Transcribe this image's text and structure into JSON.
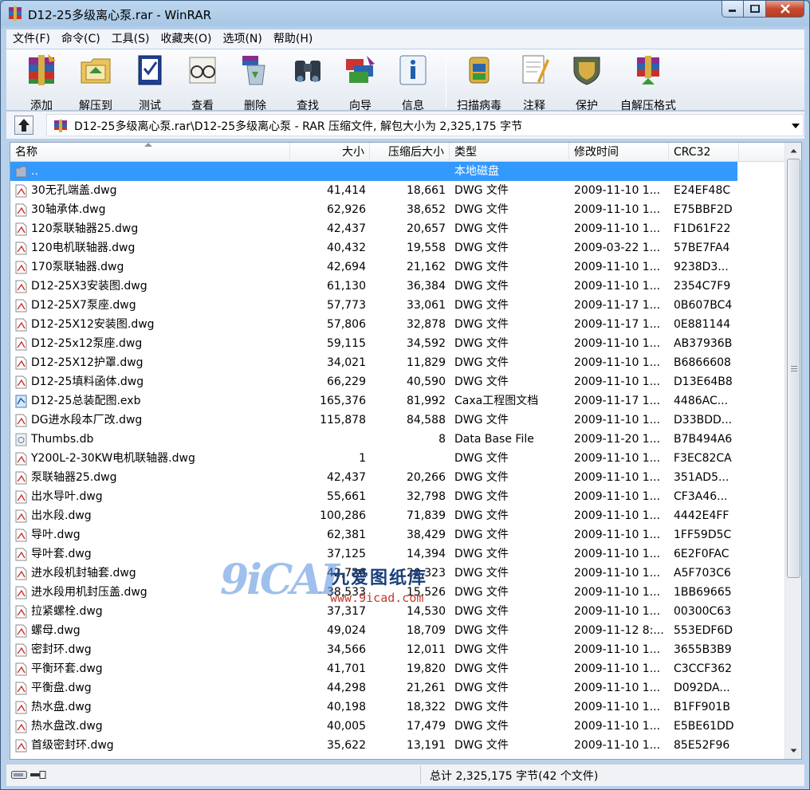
{
  "window": {
    "title": "D12-25多级离心泵.rar - WinRAR"
  },
  "menu": [
    "文件(F)",
    "命令(C)",
    "工具(S)",
    "收藏夹(O)",
    "选项(N)",
    "帮助(H)"
  ],
  "toolbar": [
    {
      "label": "添加",
      "icon": "add-books-icon"
    },
    {
      "label": "解压到",
      "icon": "extract-folder-icon"
    },
    {
      "label": "测试",
      "icon": "test-icon"
    },
    {
      "label": "查看",
      "icon": "view-glasses-icon"
    },
    {
      "label": "删除",
      "icon": "delete-recycle-icon"
    },
    {
      "label": "查找",
      "icon": "find-binoculars-icon"
    },
    {
      "label": "向导",
      "icon": "wizard-icon"
    },
    {
      "label": "信息",
      "icon": "info-icon"
    },
    {
      "label": "扫描病毒",
      "icon": "virus-scan-icon"
    },
    {
      "label": "注释",
      "icon": "comment-icon"
    },
    {
      "label": "保护",
      "icon": "protect-shield-icon"
    },
    {
      "label": "自解压格式",
      "icon": "sfx-icon"
    }
  ],
  "address": {
    "path": "D12-25多级离心泵.rar\\D12-25多级离心泵 - RAR 压缩文件, 解包大小为 2,325,175 字节"
  },
  "columns": {
    "name": "名称",
    "size": "大小",
    "packed": "压缩后大小",
    "type": "类型",
    "modified": "修改时间",
    "crc": "CRC32"
  },
  "files": [
    {
      "name": "..",
      "size": "",
      "packed": "",
      "type": "本地磁盘",
      "modified": "",
      "crc": "",
      "icon": "folder-up",
      "selected": true
    },
    {
      "name": "30无孔端盖.dwg",
      "size": "41,414",
      "packed": "18,661",
      "type": "DWG 文件",
      "modified": "2009-11-10 1...",
      "crc": "E24EF48C",
      "icon": "dwg"
    },
    {
      "name": "30轴承体.dwg",
      "size": "62,926",
      "packed": "38,652",
      "type": "DWG 文件",
      "modified": "2009-11-10 1...",
      "crc": "E75BBF2D",
      "icon": "dwg"
    },
    {
      "name": "120泵联轴器25.dwg",
      "size": "42,437",
      "packed": "20,657",
      "type": "DWG 文件",
      "modified": "2009-11-10 1...",
      "crc": "F1D61F22",
      "icon": "dwg"
    },
    {
      "name": "120电机联轴器.dwg",
      "size": "40,432",
      "packed": "19,558",
      "type": "DWG 文件",
      "modified": "2009-03-22 1...",
      "crc": "57BE7FA4",
      "icon": "dwg"
    },
    {
      "name": "170泵联轴器.dwg",
      "size": "42,694",
      "packed": "21,162",
      "type": "DWG 文件",
      "modified": "2009-11-10 1...",
      "crc": "9238D3...",
      "icon": "dwg"
    },
    {
      "name": "D12-25X3安装图.dwg",
      "size": "61,130",
      "packed": "36,384",
      "type": "DWG 文件",
      "modified": "2009-11-10 1...",
      "crc": "2354C7F9",
      "icon": "dwg"
    },
    {
      "name": "D12-25X7泵座.dwg",
      "size": "57,773",
      "packed": "33,061",
      "type": "DWG 文件",
      "modified": "2009-11-17 1...",
      "crc": "0B607BC4",
      "icon": "dwg"
    },
    {
      "name": "D12-25X12安装图.dwg",
      "size": "57,806",
      "packed": "32,878",
      "type": "DWG 文件",
      "modified": "2009-11-17 1...",
      "crc": "0E881144",
      "icon": "dwg"
    },
    {
      "name": "D12-25x12泵座.dwg",
      "size": "59,115",
      "packed": "34,592",
      "type": "DWG 文件",
      "modified": "2009-11-10 1...",
      "crc": "AB37936B",
      "icon": "dwg"
    },
    {
      "name": "D12-25X12护罩.dwg",
      "size": "34,021",
      "packed": "11,829",
      "type": "DWG 文件",
      "modified": "2009-11-10 1...",
      "crc": "B6866608",
      "icon": "dwg"
    },
    {
      "name": "D12-25填料函体.dwg",
      "size": "66,229",
      "packed": "40,590",
      "type": "DWG 文件",
      "modified": "2009-11-10 1...",
      "crc": "D13E64B8",
      "icon": "dwg"
    },
    {
      "name": "D12-25总装配图.exb",
      "size": "165,376",
      "packed": "81,992",
      "type": "Caxa工程图文档",
      "modified": "2009-11-17 1...",
      "crc": "4486AC...",
      "icon": "exb"
    },
    {
      "name": "DG进水段本厂改.dwg",
      "size": "115,878",
      "packed": "84,588",
      "type": "DWG 文件",
      "modified": "2009-11-10 1...",
      "crc": "D33BDD...",
      "icon": "dwg"
    },
    {
      "name": "Thumbs.db",
      "size": "",
      "packed": "8",
      "type": "Data Base File",
      "modified": "2009-11-20 1...",
      "crc": "B7B494A6",
      "icon": "db"
    },
    {
      "name": "Y200L-2-30KW电机联轴器.dwg",
      "size": "1",
      "packed": "",
      "type": "DWG 文件",
      "modified": "2009-11-10 1...",
      "crc": "F3EC82CA",
      "icon": "dwg"
    },
    {
      "name": "泵联轴器25.dwg",
      "size": "42,437",
      "packed": "20,266",
      "type": "DWG 文件",
      "modified": "2009-11-10 1...",
      "crc": "351AD5...",
      "icon": "dwg"
    },
    {
      "name": "出水导叶.dwg",
      "size": "55,661",
      "packed": "32,798",
      "type": "DWG 文件",
      "modified": "2009-11-10 1...",
      "crc": "CF3A46...",
      "icon": "dwg"
    },
    {
      "name": "出水段.dwg",
      "size": "100,286",
      "packed": "71,839",
      "type": "DWG 文件",
      "modified": "2009-11-10 1...",
      "crc": "4442E4FF",
      "icon": "dwg"
    },
    {
      "name": "导叶.dwg",
      "size": "62,381",
      "packed": "38,429",
      "type": "DWG 文件",
      "modified": "2009-11-10 1...",
      "crc": "1FF59D5C",
      "icon": "dwg"
    },
    {
      "name": "导叶套.dwg",
      "size": "37,125",
      "packed": "14,394",
      "type": "DWG 文件",
      "modified": "2009-11-10 1...",
      "crc": "6E2F0FAC",
      "icon": "dwg"
    },
    {
      "name": "进水段机封轴套.dwg",
      "size": "42,726",
      "packed": "20,323",
      "type": "DWG 文件",
      "modified": "2009-11-10 1...",
      "crc": "A5F703C6",
      "icon": "dwg"
    },
    {
      "name": "进水段用机封压盖.dwg",
      "size": "38,533",
      "packed": "15,526",
      "type": "DWG 文件",
      "modified": "2009-11-10 1...",
      "crc": "1BB69665",
      "icon": "dwg"
    },
    {
      "name": "拉紧螺栓.dwg",
      "size": "37,317",
      "packed": "14,530",
      "type": "DWG 文件",
      "modified": "2009-11-10 1...",
      "crc": "00300C63",
      "icon": "dwg"
    },
    {
      "name": "螺母.dwg",
      "size": "49,024",
      "packed": "18,709",
      "type": "DWG 文件",
      "modified": "2009-11-12 8:...",
      "crc": "553EDF6D",
      "icon": "dwg"
    },
    {
      "name": "密封环.dwg",
      "size": "34,566",
      "packed": "12,011",
      "type": "DWG 文件",
      "modified": "2009-11-10 1...",
      "crc": "3655B3B9",
      "icon": "dwg"
    },
    {
      "name": "平衡环套.dwg",
      "size": "41,701",
      "packed": "19,820",
      "type": "DWG 文件",
      "modified": "2009-11-10 1...",
      "crc": "C3CCF362",
      "icon": "dwg"
    },
    {
      "name": "平衡盘.dwg",
      "size": "44,298",
      "packed": "21,261",
      "type": "DWG 文件",
      "modified": "2009-11-10 1...",
      "crc": "D092DA...",
      "icon": "dwg"
    },
    {
      "name": "热水盘.dwg",
      "size": "40,198",
      "packed": "18,322",
      "type": "DWG 文件",
      "modified": "2009-11-10 1...",
      "crc": "B1FF901B",
      "icon": "dwg"
    },
    {
      "name": "热水盘改.dwg",
      "size": "40,005",
      "packed": "17,479",
      "type": "DWG 文件",
      "modified": "2009-11-10 1...",
      "crc": "E5BE61DD",
      "icon": "dwg"
    },
    {
      "name": "首级密封环.dwg",
      "size": "35,622",
      "packed": "13,191",
      "type": "DWG 文件",
      "modified": "2009-11-10 1...",
      "crc": "85E52F96",
      "icon": "dwg"
    }
  ],
  "watermark": {
    "logo": "9iCAI",
    "name": "九爱图纸库",
    "url": "www.9icad.com"
  },
  "status": {
    "summary": "总计 2,325,175 字节(42 个文件)"
  }
}
